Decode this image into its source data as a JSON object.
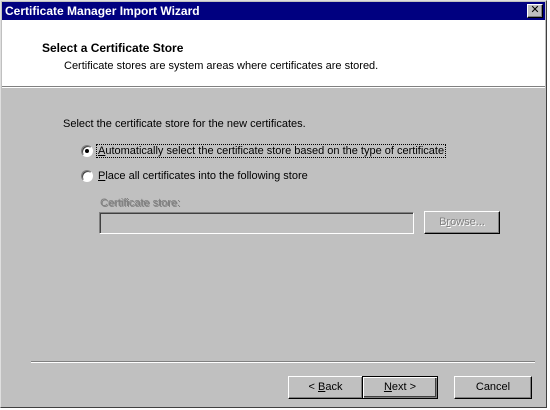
{
  "window": {
    "title": "Certificate Manager Import Wizard",
    "close_glyph": "✕"
  },
  "header": {
    "title": "Select a Certificate Store",
    "subtitle": "Certificate stores are system areas where certificates are stored."
  },
  "body": {
    "instruction": "Select the certificate store for the new certificates.",
    "options": [
      {
        "mnemonic": "A",
        "rest": "utomatically select the certificate store based on the type of certificate",
        "selected": true
      },
      {
        "mnemonic": "P",
        "rest": "lace all certificates into the following store",
        "selected": false
      }
    ],
    "store_label": "Certificate store:",
    "store_value": "",
    "browse": {
      "before": "B",
      "mnemonic": "r",
      "after": "owse..."
    }
  },
  "footer": {
    "back": {
      "prefix": "< ",
      "mnemonic": "B",
      "rest": "ack"
    },
    "next": {
      "mnemonic": "N",
      "rest": "ext >"
    },
    "cancel": "Cancel"
  }
}
